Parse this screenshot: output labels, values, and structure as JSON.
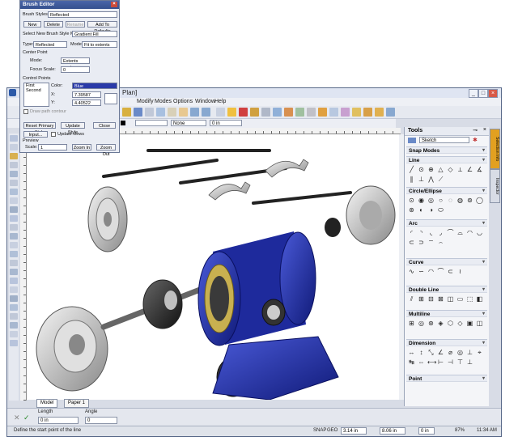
{
  "window": {
    "title_fragment": "Plan]",
    "controls": [
      "_",
      "□",
      "×"
    ]
  },
  "menu": [
    "Modify",
    "Modes",
    "Options",
    "Window",
    "Help"
  ],
  "toolbar": {
    "layer_combo": "",
    "line_combo": "None",
    "width_combo": "0 in"
  },
  "tabs": [
    "Model",
    "Paper 1"
  ],
  "status_inputs": {
    "length_label": "Length",
    "angle_label": "Angle",
    "length_value": "0 in",
    "angle_value": "0"
  },
  "statusbar": {
    "prompt": "Define the start point of the line",
    "snap": "SNAP",
    "geo": "GEO",
    "x_value": "3.14 in",
    "y_value": "8.06 in",
    "z_value": "0 in",
    "zoom": "87%",
    "time": "11:34 AM"
  },
  "tools_panel": {
    "title": "Tools",
    "dropdown": "Sketch",
    "sections": [
      {
        "name": "Snap Modes",
        "rows": 0
      },
      {
        "name": "Line",
        "icons": [
          "╱",
          "⊙",
          "⊕",
          "△",
          "◇",
          "⟂",
          "∠",
          "∡",
          "∥",
          "⊥",
          "⋀",
          "⟋"
        ]
      },
      {
        "name": "Circle/Ellipse",
        "icons": [
          "⊙",
          "◉",
          "◎",
          "○",
          "◌",
          "◍",
          "⊚",
          "◯",
          "⊛",
          "◐",
          "◑",
          "⬭"
        ]
      },
      {
        "name": "Arc",
        "icons": [
          "◜",
          "◝",
          "◟",
          "◞",
          "⌒",
          "⌓",
          "◠",
          "◡",
          "⊂",
          "⊃",
          "⌔",
          "⌢"
        ]
      },
      {
        "name": "Curve",
        "icons": [
          "∿",
          "∽",
          "◠",
          "⌒",
          "⊂",
          "≀"
        ]
      },
      {
        "name": "Double Line",
        "icons": [
          "⫽",
          "⊞",
          "⊟",
          "⊠",
          "◫",
          "▭",
          "⬚",
          "◧",
          "◨",
          "⬓"
        ]
      },
      {
        "name": "Multiline",
        "icons": [
          "⊞",
          "◎",
          "⊛",
          "◈",
          "⬡",
          "◇",
          "▣",
          "◫",
          "⊟",
          "⊠"
        ]
      },
      {
        "name": "Dimension",
        "icons": [
          "↔",
          "↕",
          "⤡",
          "∠",
          "⌀",
          "◎",
          "⊥",
          "⌖",
          "↹",
          "⇔",
          "⟷",
          "⊢",
          "⊣",
          "⊤",
          "⊥"
        ]
      },
      {
        "name": "Point",
        "icons": []
      }
    ],
    "side_tabs": [
      "Selection Info",
      "Inspector"
    ]
  },
  "brush_editor": {
    "title": "Brush Editor",
    "brush_styles_label": "Brush Styles:",
    "brush_styles_value": "Reflected",
    "btn_new": "New",
    "btn_delete": "Delete",
    "btn_rename": "Rename",
    "btn_add_defaults": "Add To Defaults",
    "select_mode_label": "Select New Brush Style Mode:",
    "mode_value": "Gradient Fill",
    "type_label": "Type:",
    "type_value": "Reflected",
    "mode_label": "Mode:",
    "mode2_value": "Fit to extents",
    "center_point_label": "Center Point",
    "cp_mode_label": "Mode:",
    "cp_mode_value": "Extents center",
    "focus_scale_label": "Focus Scale:",
    "focus_scale_value": "0",
    "control_points_label": "Control Points",
    "cp_col": "",
    "cp_first": "First",
    "cp_second": "Second",
    "color_label": "Color:",
    "color_value": "Blue",
    "x_label": "X:",
    "x_value": "7.39587",
    "y_label": "Y:",
    "y_value": "4.40522",
    "draw_path_label": "Draw path contour",
    "btn_reset": "Reset Primary Style",
    "btn_update_style": "Update Style",
    "btn_close": "Close",
    "btn_input": "Input...",
    "update_views_label": "Update views",
    "preview_label": "Preview",
    "scale_label": "Scale:",
    "scale_value": "1",
    "btn_zoom_in": "Zoom In",
    "btn_zoom_out": "Zoom Out"
  },
  "colors": {
    "accent": "#2a3aa8",
    "motor_blue": "#1e2a9c",
    "brush_title": "#3a56a0",
    "tools_highlight": "#e2a020"
  }
}
